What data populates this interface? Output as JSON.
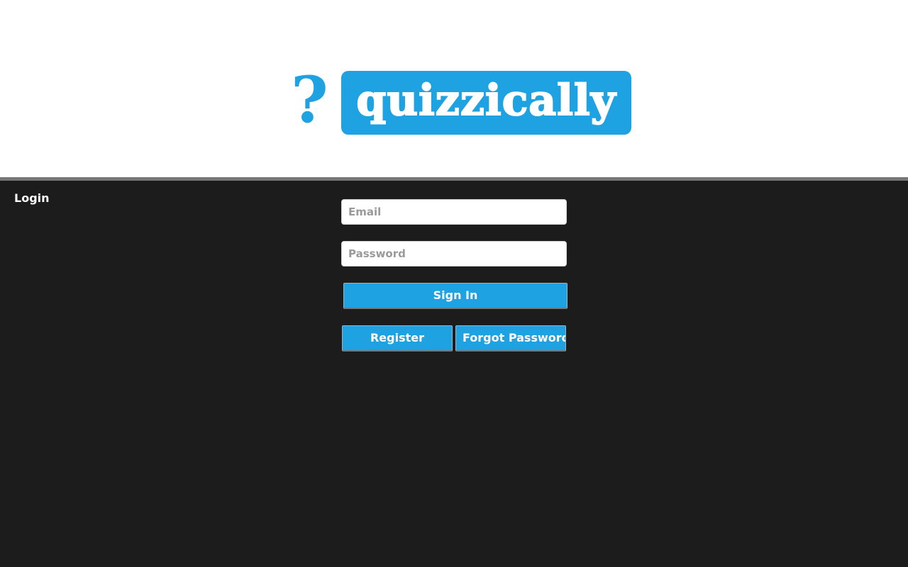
{
  "logo": {
    "icon": "question-mark-icon",
    "icon_glyph": "?",
    "wordmark": "quizzically",
    "brand_color": "#1ea2e2"
  },
  "page": {
    "title": "Login",
    "background_color": "#1c1c1c"
  },
  "form": {
    "email_placeholder": "Email",
    "password_placeholder": "Password",
    "signin_label": "Sign In",
    "register_label": "Register",
    "forgot_label": "Forgot Password?"
  }
}
